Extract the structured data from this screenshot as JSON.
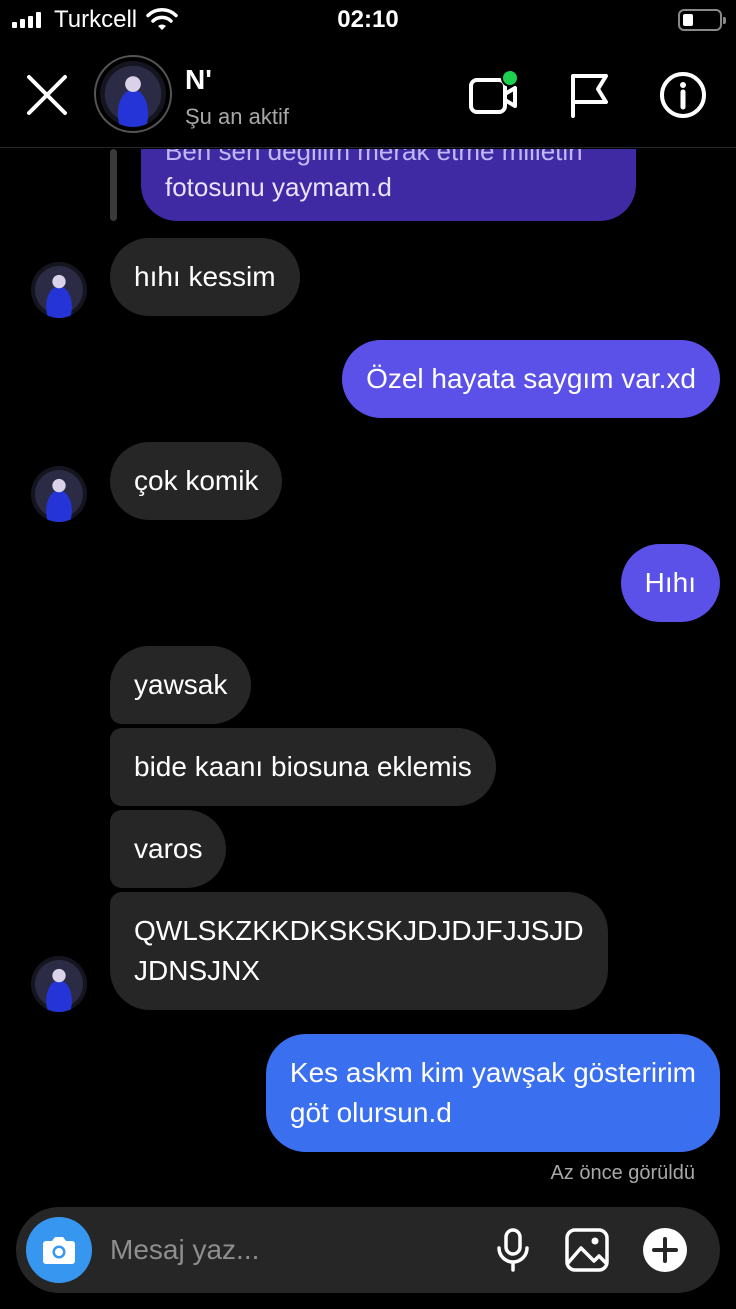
{
  "status_bar": {
    "carrier": "Turkcell",
    "time": "02:10"
  },
  "header": {
    "name": "N'",
    "status": "Şu an aktif",
    "icons": [
      "close-icon",
      "video-call-icon",
      "flag-icon",
      "info-icon"
    ],
    "online_color": "#1cd14f"
  },
  "conversation": {
    "quoted": {
      "line1_cut": "Ben sen değilim merak etme milletin",
      "line2": "fotosunu yaymam.d"
    },
    "messages": [
      {
        "side": "in",
        "text": "hıhı kessim"
      },
      {
        "side": "out",
        "text": "Özel hayata saygım var.xd"
      },
      {
        "side": "in",
        "text": "çok komik"
      },
      {
        "side": "out",
        "text": "Hıhı"
      },
      {
        "side": "in",
        "text": "yawsak"
      },
      {
        "side": "in",
        "text": "bide kaanı biosuna eklemis"
      },
      {
        "side": "in",
        "text": "varos"
      },
      {
        "side": "in",
        "lines": [
          "QWLSKZKKDKSKSKJDJDJFJJSJD",
          "JDNSJNX"
        ]
      },
      {
        "side": "out",
        "lines": [
          "Kes askm kim yawşak gösteririm",
          "göt olursun.d"
        ]
      }
    ],
    "seen_label": "Az önce görüldü"
  },
  "composer": {
    "placeholder": "Mesaj yaz...",
    "icons": [
      "camera-icon",
      "microphone-icon",
      "gallery-icon",
      "plus-icon"
    ]
  },
  "colors": {
    "incoming": "#262626",
    "outgoing": "#5b51e8",
    "outgoing_last": "#3a6ff0",
    "camera": "#3797f0"
  }
}
